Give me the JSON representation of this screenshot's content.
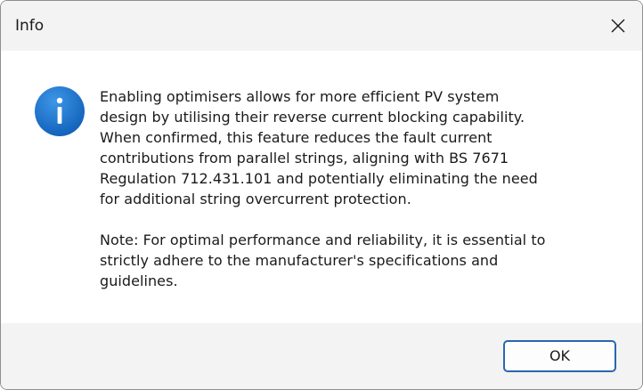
{
  "window": {
    "title": "Info",
    "close_icon": "close-icon"
  },
  "message": {
    "icon": "info-icon",
    "paragraph1": "Enabling optimisers allows for more efficient PV system\ndesign by utilising their reverse current blocking capability.\nWhen confirmed, this feature reduces the fault current\ncontributions from parallel strings, aligning with BS 7671\nRegulation 712.431.101 and potentially eliminating the need\nfor additional string overcurrent protection.",
    "paragraph2": "Note: For optimal performance and reliability, it is essential to\nstrictly adhere to the manufacturer's specifications and\nguidelines."
  },
  "footer": {
    "ok_label": "OK"
  },
  "colors": {
    "icon_blue": "#1a73c9",
    "button_border": "#2a66b0",
    "titlebar_bg": "#f3f3f3"
  }
}
